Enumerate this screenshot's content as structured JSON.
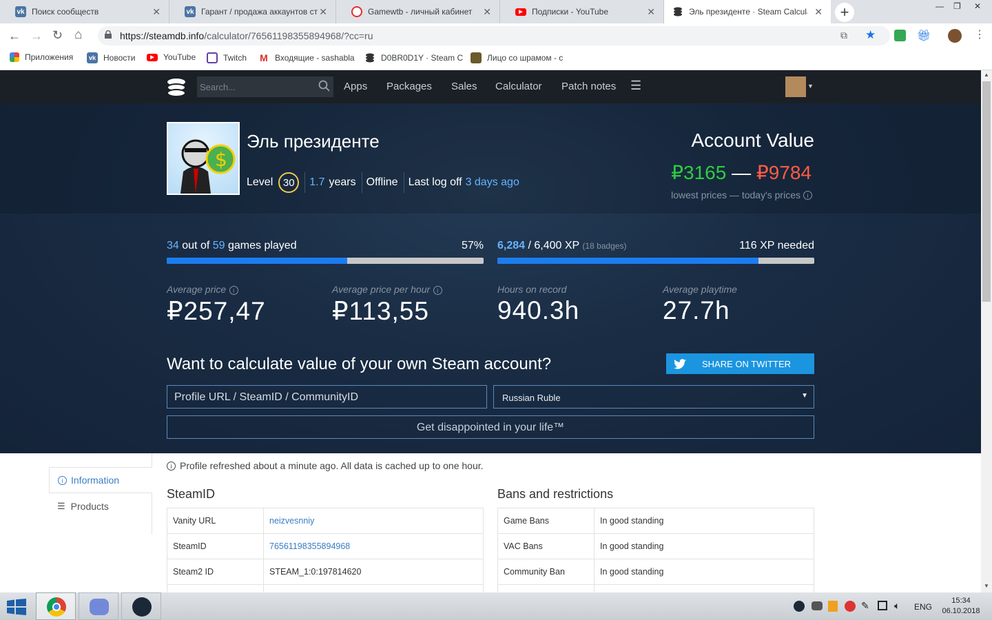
{
  "tabs": [
    {
      "title": "Поиск сообществ",
      "icon": "vk-icon",
      "color": "#4c75a3",
      "glyph": "vk"
    },
    {
      "title": "Гарант / продажа аккаунтов ст",
      "icon": "vk-icon",
      "color": "#4c75a3",
      "glyph": "vk"
    },
    {
      "title": "Gamewtb - личный кабинет",
      "icon": "gamewtb-icon",
      "color": "#e03030",
      "glyph": "◎"
    },
    {
      "title": "Подписки - YouTube",
      "icon": "youtube-icon",
      "color": "#ff0000",
      "glyph": "▶"
    },
    {
      "title": "Эль президенте · Steam Calculat",
      "icon": "steamdb-icon",
      "color": "#333333",
      "glyph": "≋"
    }
  ],
  "address": {
    "url_host": "https://steamdb.info",
    "url_path": "/calculator/76561198355894968/?cc=ru"
  },
  "bookmarks": [
    {
      "label": "Приложения",
      "icon": "apps-grid-icon"
    },
    {
      "label": "Новости",
      "icon": "vk-icon"
    },
    {
      "label": "YouTube",
      "icon": "youtube-icon"
    },
    {
      "label": "Twitch",
      "icon": "twitch-icon"
    },
    {
      "label": "Входящие - sashabla",
      "icon": "gmail-icon"
    },
    {
      "label": "D0BR0D1Y · Steam C",
      "icon": "steamdb-icon"
    },
    {
      "label": "Лицо со шрамом - с",
      "icon": "movie-icon"
    }
  ],
  "nav": {
    "search_placeholder": "Search...",
    "links": [
      "Apps",
      "Packages",
      "Sales",
      "Calculator",
      "Patch notes"
    ]
  },
  "profile": {
    "name": "Эль президенте",
    "level_label": "Level",
    "level": "30",
    "years_num": "1.7",
    "years_word": "years",
    "status": "Offline",
    "last_logoff_label": "Last log off",
    "last_logoff_value": "3 days ago"
  },
  "account": {
    "title": "Account Value",
    "low": "₽3165",
    "dash": "—",
    "high": "₽9784",
    "note": "lowest prices — today's prices"
  },
  "games": {
    "played": "34",
    "of": "out of",
    "total": "59",
    "suffix": "games played",
    "percent": "57%",
    "fraction": 0.57
  },
  "xp": {
    "current": "6,284",
    "max": "/ 6,400 XP",
    "badges": "(18 badges)",
    "needed": "116 XP needed",
    "fraction": 0.9819
  },
  "stats": [
    {
      "label": "Average price",
      "value": "₽257,47",
      "info": true
    },
    {
      "label": "Average price per hour",
      "value": "₽113,55",
      "info": true
    },
    {
      "label": "Hours on record",
      "value": "940.3h",
      "info": false
    },
    {
      "label": "Average playtime",
      "value": "27.7h",
      "info": false
    }
  ],
  "calc": {
    "heading": "Want to calculate value of your own Steam account?",
    "twitter": "SHARE ON TWITTER",
    "input_placeholder": "Profile URL / SteamID / CommunityID",
    "currency": "Russian Ruble",
    "button": "Get disappointed in your life™"
  },
  "sidebar": {
    "items": [
      "Information",
      "Products"
    ]
  },
  "notice": "Profile refreshed about a minute ago. All data is cached up to one hour.",
  "steamid": {
    "heading": "SteamID",
    "rows": [
      {
        "k": "Vanity URL",
        "v": "neizvesnniy",
        "link": true
      },
      {
        "k": "SteamID",
        "v": "76561198355894968",
        "link": true
      },
      {
        "k": "Steam2 ID",
        "v": "STEAM_1:0:197814620",
        "link": false
      }
    ]
  },
  "bans": {
    "heading": "Bans and restrictions",
    "rows": [
      {
        "k": "Game Bans",
        "v": "In good standing"
      },
      {
        "k": "VAC Bans",
        "v": "In good standing"
      },
      {
        "k": "Community Ban",
        "v": "In good standing"
      }
    ]
  },
  "taskbar": {
    "lang": "ENG",
    "time": "15:34",
    "date": "06.10.2018"
  },
  "colors": {
    "accent": "#1b7df0",
    "green": "#2ecc40",
    "red": "#ff5b45",
    "link": "#3a7dc4"
  }
}
